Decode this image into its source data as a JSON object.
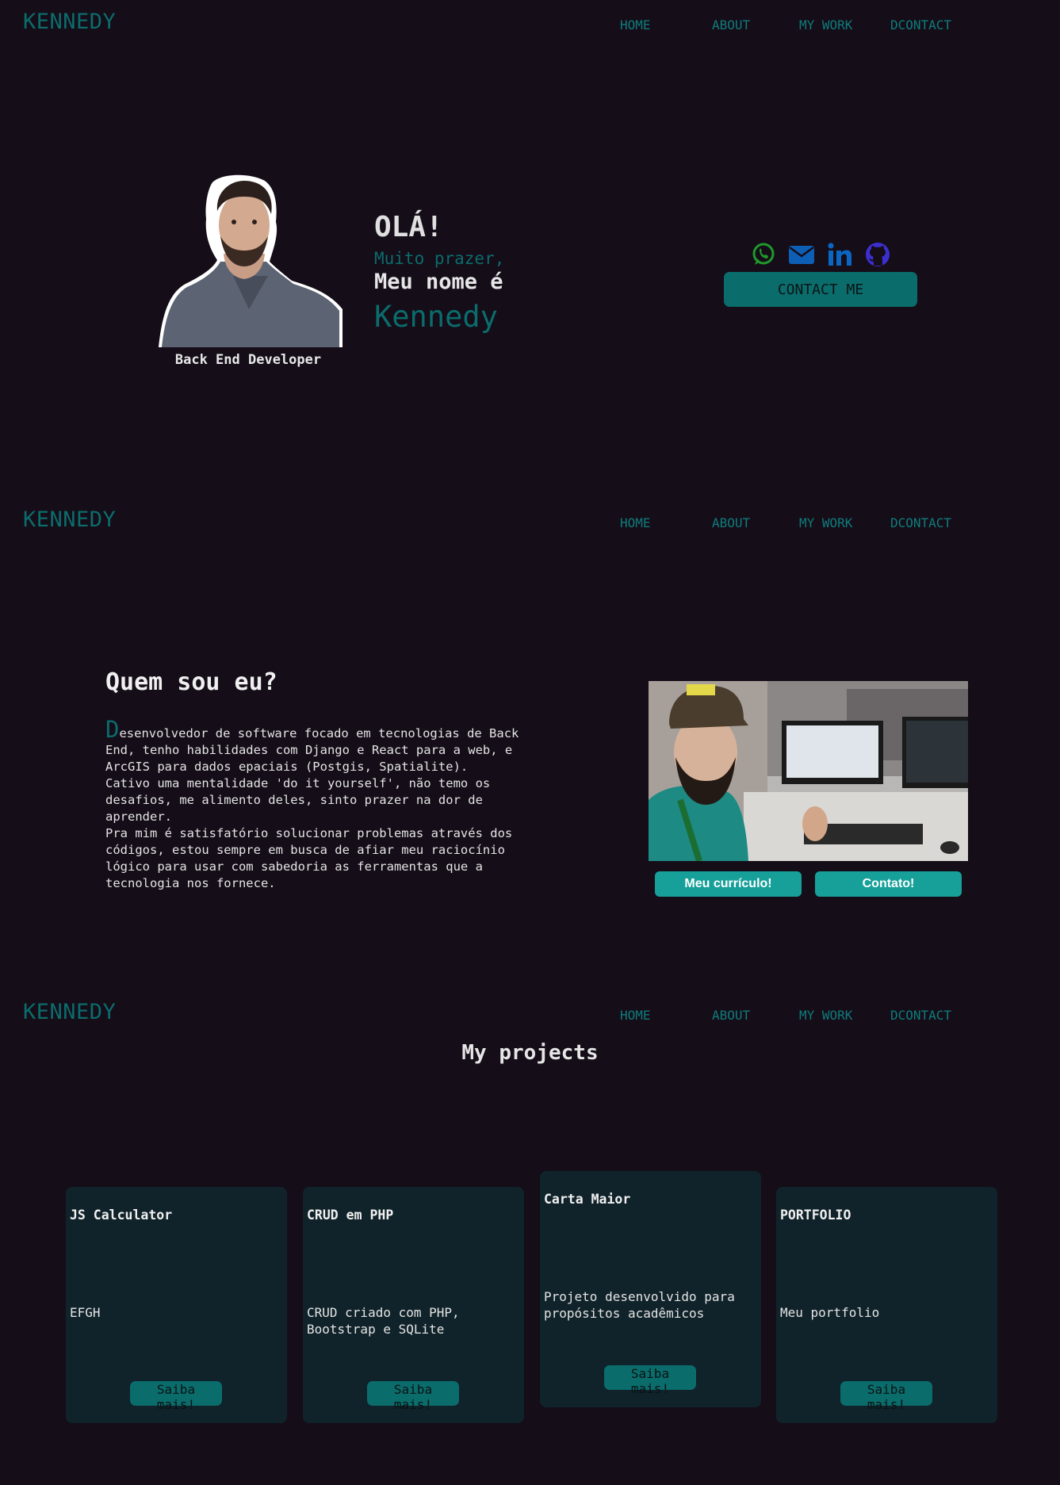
{
  "brand": "KENNEDY",
  "nav": {
    "home": "HOME",
    "about": "ABOUT",
    "work": "MY WORK",
    "contact": "DCONTACT"
  },
  "hero": {
    "greeting": "OLÁ!",
    "line1": "Muito prazer,",
    "line2": "Meu nome é",
    "name": "Kennedy",
    "role": "Back End Developer",
    "contact_button": "CONTACT ME",
    "socials": [
      {
        "icon": "whatsapp-icon",
        "color": "#1e9a2a"
      },
      {
        "icon": "envelope-icon",
        "color": "#0d5fb5"
      },
      {
        "icon": "linkedin-icon",
        "color": "#0a66c2"
      },
      {
        "icon": "github-icon",
        "color": "#3b2fd0"
      }
    ]
  },
  "about": {
    "title": "Quem sou eu?",
    "dropcap": "D",
    "p1": "esenvolvedor de software focado em tecnologias de Back End, tenho habilidades com Django e React para a web, e ArcGIS para dados epaciais (Postgis, Spatialite).",
    "p2": "Cativo uma mentalidade 'do it yourself', não temo os desafios, me alimento deles, sinto prazer na dor de aprender.",
    "p3": "Pra mim é satisfatório solucionar problemas através dos códigos, estou sempre em busca de afiar meu raciocínio lógico para usar com sabedoria as ferramentas que a tecnologia nos fornece.",
    "cv_button": "Meu currículo!",
    "contact_button": "Contato!"
  },
  "projects": {
    "title": "My projects",
    "button_label": "Saiba mais!",
    "items": [
      {
        "title": "JS Calculator",
        "desc": "EFGH"
      },
      {
        "title": "CRUD em PHP",
        "desc": "CRUD criado com PHP, Bootstrap e SQLite"
      },
      {
        "title": "Carta Maior",
        "desc": "Projeto desenvolvido para propósitos acadêmicos"
      },
      {
        "title": "PORTFOLIO",
        "desc": "Meu portfolio"
      }
    ]
  },
  "colors": {
    "background": "#150d18",
    "accent": "#0b6c6c",
    "button": "#17a09a",
    "card": "#10232a"
  }
}
